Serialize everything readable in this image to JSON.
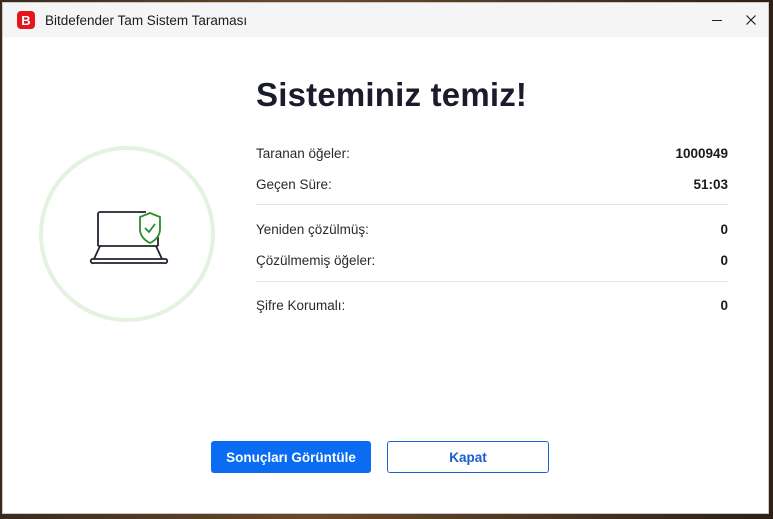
{
  "window": {
    "title": "Bitdefender Tam Sistem Taraması",
    "logo_letter": "B",
    "brand_color": "#e4151f"
  },
  "result": {
    "headline": "Sisteminiz temiz!",
    "status_icon": "laptop-shield-check-icon",
    "status_color": "#2e8b2e"
  },
  "stats": [
    {
      "label": "Taranan öğeler:",
      "value": "1000949"
    },
    {
      "label": "Geçen Süre:",
      "value": "51:03"
    },
    {
      "label": "Yeniden çözülmüş:",
      "value": "0"
    },
    {
      "label": "Çözülmemiş öğeler:",
      "value": "0"
    },
    {
      "label": "Şifre Korumalı:",
      "value": "0"
    }
  ],
  "buttons": {
    "view_results": "Sonuçları Görüntüle",
    "close": "Kapat"
  },
  "accent_color": "#0a6cf2"
}
